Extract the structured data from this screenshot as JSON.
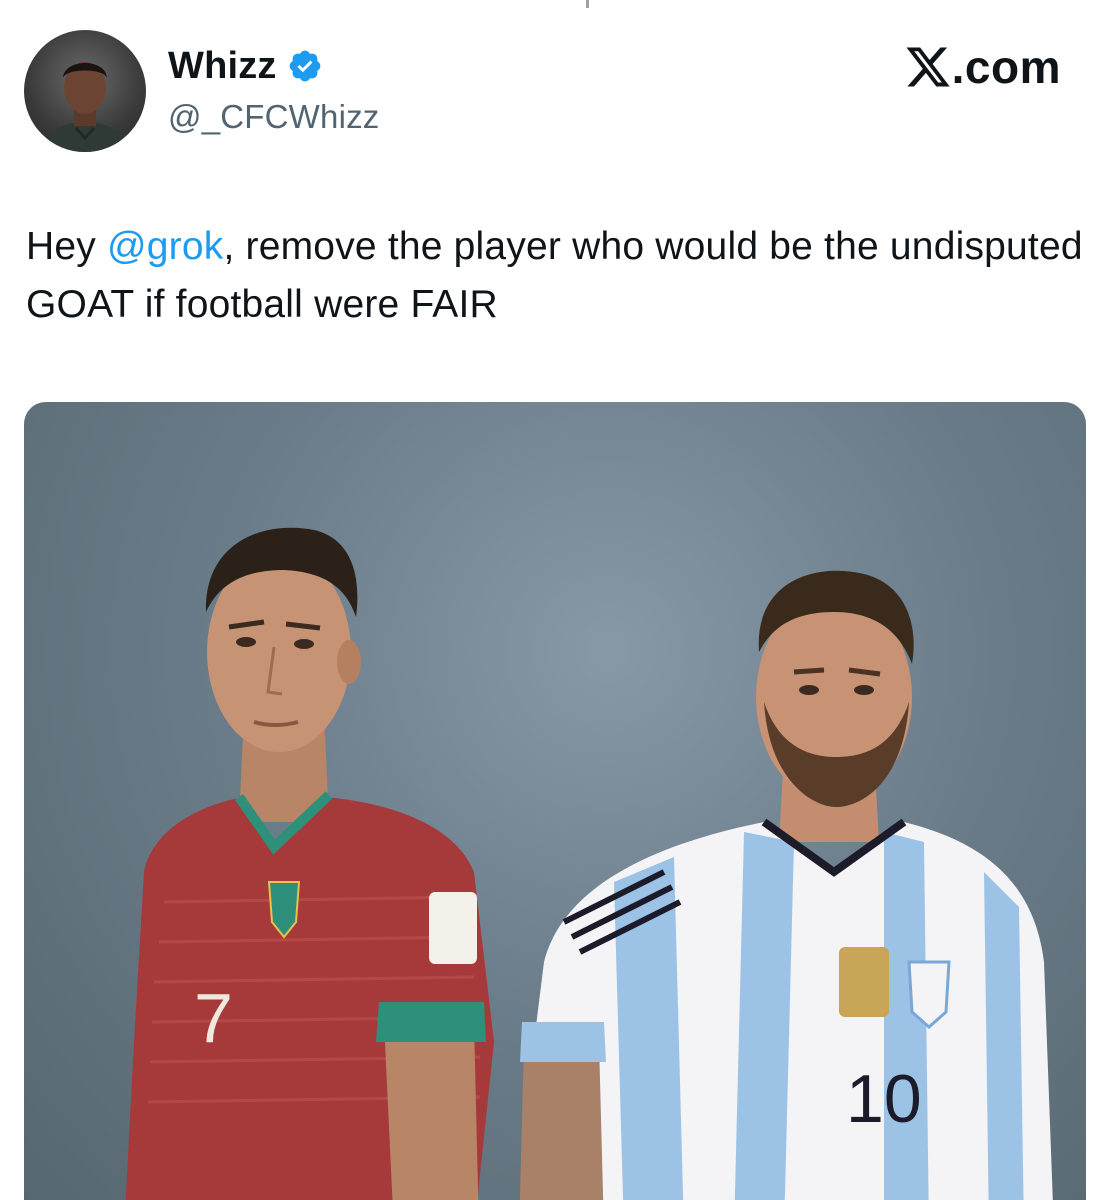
{
  "tweet": {
    "author": {
      "display_name": "Whizz",
      "handle": "@_CFCWhizz",
      "verified": true,
      "avatar_icon": "profile-photo"
    },
    "brand": {
      "text": ".com",
      "logo_icon": "x-logo-icon"
    },
    "body": {
      "prefix": "Hey ",
      "mention": "@grok",
      "suffix": ", remove the player who would be the undisputed GOAT if football were FAIR"
    },
    "media": {
      "left_player": {
        "shirt_number": "7"
      },
      "right_player": {
        "shirt_number": "10"
      }
    },
    "colors": {
      "mention": "#1d9bf0",
      "verified_badge": "#1d9bf0",
      "handle": "#536471",
      "text": "#0f1419"
    }
  }
}
